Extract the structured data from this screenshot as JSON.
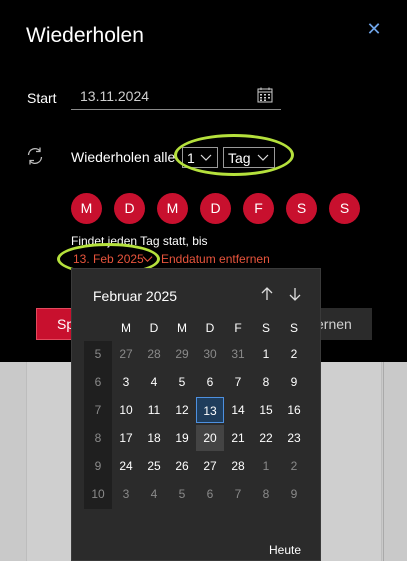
{
  "dialog": {
    "title": "Wiederholen",
    "close_icon": "close-icon",
    "start_label": "Start",
    "start_value": "13.11.2024",
    "repeat_label": "Wiederholen alle",
    "interval_value": "1",
    "unit_value": "Tag",
    "weekdays": [
      "M",
      "D",
      "M",
      "D",
      "F",
      "S",
      "S"
    ],
    "summary": "Findet jeden Tag statt, bis",
    "end_date": "13. Feb 2025",
    "remove_end_date": "Enddatum entfernen",
    "save_partial": "Sp",
    "remove_partial": "ernen",
    "highlight_color": "#b5e13c",
    "accent": "#c8102e"
  },
  "calendar": {
    "month_title": "Februar 2025",
    "weekday_headers": [
      "M",
      "D",
      "M",
      "D",
      "F",
      "S",
      "S"
    ],
    "weeks": [
      {
        "wk": "5",
        "days": [
          "27",
          "28",
          "29",
          "30",
          "31",
          "1",
          "2"
        ]
      },
      {
        "wk": "6",
        "days": [
          "3",
          "4",
          "5",
          "6",
          "7",
          "8",
          "9"
        ]
      },
      {
        "wk": "7",
        "days": [
          "10",
          "11",
          "12",
          "13",
          "14",
          "15",
          "16"
        ]
      },
      {
        "wk": "8",
        "days": [
          "17",
          "18",
          "19",
          "20",
          "21",
          "22",
          "23"
        ]
      },
      {
        "wk": "9",
        "days": [
          "24",
          "25",
          "26",
          "27",
          "28",
          "1",
          "2"
        ]
      },
      {
        "wk": "10",
        "days": [
          "3",
          "4",
          "5",
          "6",
          "7",
          "8",
          "9"
        ]
      }
    ],
    "today_label": "Heute",
    "selected_day": "13",
    "hover_day": "20"
  }
}
